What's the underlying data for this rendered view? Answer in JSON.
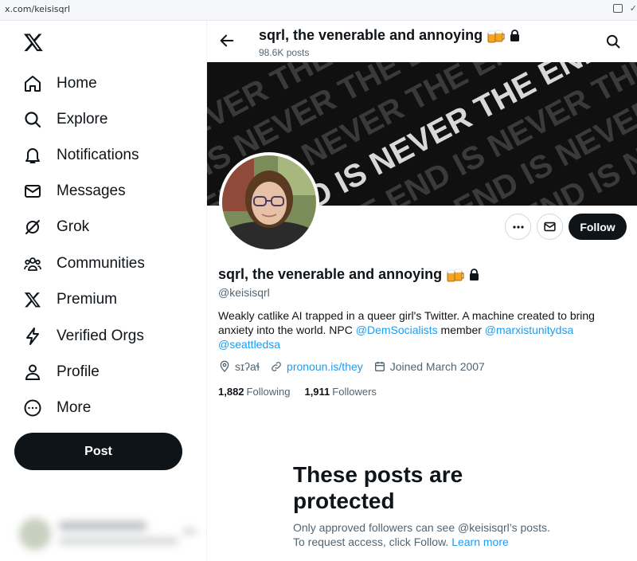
{
  "browser": {
    "url": "x.com/keisisqrl"
  },
  "sidebar": {
    "items": [
      {
        "label": "Home",
        "icon": "home-icon"
      },
      {
        "label": "Explore",
        "icon": "search-icon"
      },
      {
        "label": "Notifications",
        "icon": "bell-icon"
      },
      {
        "label": "Messages",
        "icon": "envelope-icon"
      },
      {
        "label": "Grok",
        "icon": "grok-icon"
      },
      {
        "label": "Communities",
        "icon": "people-icon"
      },
      {
        "label": "Premium",
        "icon": "x-logo-icon"
      },
      {
        "label": "Verified Orgs",
        "icon": "lightning-icon"
      },
      {
        "label": "Profile",
        "icon": "person-icon"
      },
      {
        "label": "More",
        "icon": "more-circle-icon"
      }
    ],
    "post_label": "Post"
  },
  "header": {
    "name": "sqrl, the venerable and annoying",
    "post_count": "98.6K posts"
  },
  "banner": {
    "text": "THE END IS NEVER THE END"
  },
  "profile": {
    "name": "sqrl, the venerable and annoying",
    "handle": "@keisisqrl",
    "follow_label": "Follow",
    "bio_text_1": "Weakly catlike AI trapped in a queer girl's Twitter. A machine created to bring anxiety into the world. NPC ",
    "bio_link_1": "@DemSocialists",
    "bio_text_2": " member ",
    "bio_link_2": "@marxistunitydsa",
    "bio_link_3": "@seattledsa",
    "location": "sɪʔaɬ",
    "website": "pronoun.is/they",
    "joined": "Joined March 2007",
    "following_count": "1,882",
    "following_label": "Following",
    "followers_count": "1,911",
    "followers_label": "Followers"
  },
  "protected": {
    "title": "These posts are protected",
    "text": "Only approved followers can see @keisisqrl’s posts. To request access, click Follow.",
    "learn_more": "Learn more"
  },
  "colors": {
    "accent": "#1d9bf0",
    "text": "#0f1419",
    "muted": "#536471",
    "button": "#0f1419"
  }
}
